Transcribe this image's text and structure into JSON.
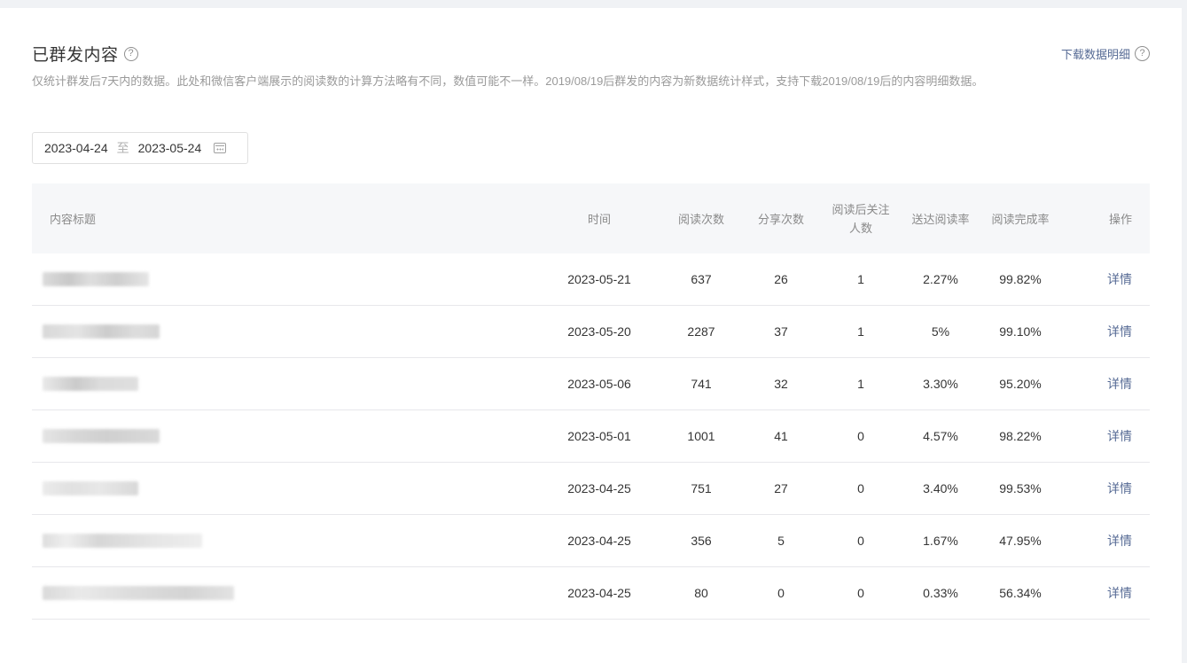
{
  "header": {
    "title": "已群发内容",
    "download_label": "下载数据明细",
    "description": "仅统计群发后7天内的数据。此处和微信客户端展示的阅读数的计算方法略有不同，数值可能不一样。2019/08/19后群发的内容为新数据统计样式，支持下载2019/08/19后的内容明细数据。"
  },
  "date_range": {
    "start": "2023-04-24",
    "separator": "至",
    "end": "2023-05-24"
  },
  "table": {
    "columns": {
      "title": "内容标题",
      "time": "时间",
      "reads": "阅读次数",
      "shares": "分享次数",
      "follows": "阅读后关注人数",
      "delivery_rate": "送达阅读率",
      "completion_rate": "阅读完成率",
      "action": "操作"
    },
    "rows": [
      {
        "time": "2023-05-21",
        "reads": "637",
        "shares": "26",
        "follows": "1",
        "delivery_rate": "2.27%",
        "completion_rate": "99.82%",
        "action": "详情"
      },
      {
        "time": "2023-05-20",
        "reads": "2287",
        "shares": "37",
        "follows": "1",
        "delivery_rate": "5%",
        "completion_rate": "99.10%",
        "action": "详情"
      },
      {
        "time": "2023-05-06",
        "reads": "741",
        "shares": "32",
        "follows": "1",
        "delivery_rate": "3.30%",
        "completion_rate": "95.20%",
        "action": "详情"
      },
      {
        "time": "2023-05-01",
        "reads": "1001",
        "shares": "41",
        "follows": "0",
        "delivery_rate": "4.57%",
        "completion_rate": "98.22%",
        "action": "详情"
      },
      {
        "time": "2023-04-25",
        "reads": "751",
        "shares": "27",
        "follows": "0",
        "delivery_rate": "3.40%",
        "completion_rate": "99.53%",
        "action": "详情"
      },
      {
        "time": "2023-04-25",
        "reads": "356",
        "shares": "5",
        "follows": "0",
        "delivery_rate": "1.67%",
        "completion_rate": "47.95%",
        "action": "详情"
      },
      {
        "time": "2023-04-25",
        "reads": "80",
        "shares": "0",
        "follows": "0",
        "delivery_rate": "0.33%",
        "completion_rate": "56.34%",
        "action": "详情"
      }
    ]
  },
  "colors": {
    "link": "#576b95",
    "muted_text": "#9a9a9a",
    "header_bg": "#f6f7f9"
  },
  "icons": {
    "help": "question-circle-icon",
    "calendar": "calendar-icon"
  }
}
